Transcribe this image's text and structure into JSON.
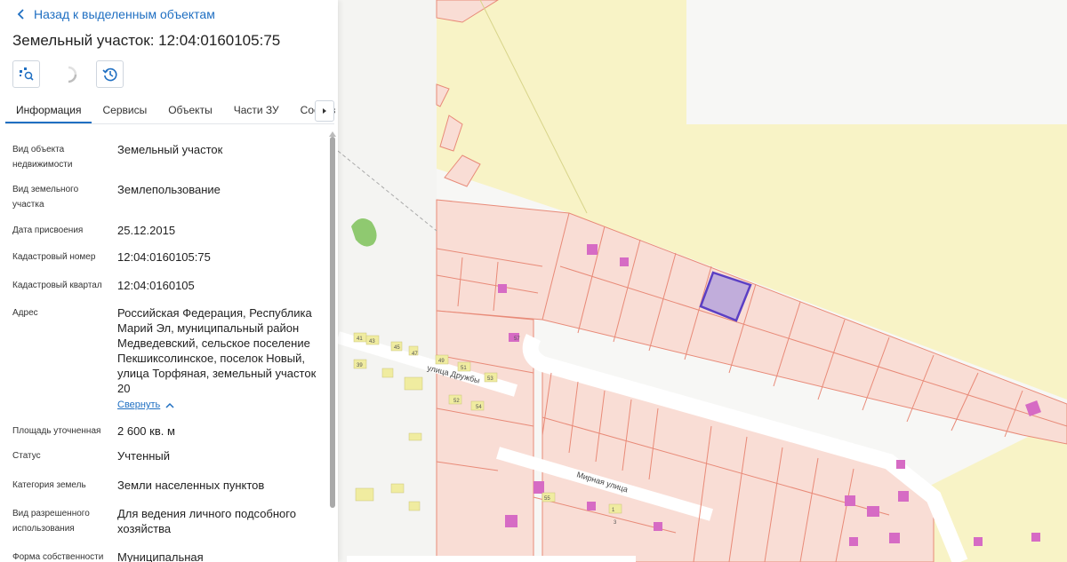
{
  "panel": {
    "back_label": "Назад к выделенным объектам",
    "title": "Земельный участок: 12:04:0160105:75",
    "tabs": [
      {
        "label": "Информация",
        "active": true
      },
      {
        "label": "Сервисы"
      },
      {
        "label": "Объекты"
      },
      {
        "label": "Части ЗУ"
      },
      {
        "label": "Состав"
      }
    ],
    "fields": [
      {
        "label": "Вид объекта недвижимости",
        "value": "Земельный участок"
      },
      {
        "label": "Вид земельного участка",
        "value": "Землепользование"
      },
      {
        "label": "Дата присвоения",
        "value": "25.12.2015"
      },
      {
        "label": "Кадастровый номер",
        "value": "12:04:0160105:75"
      },
      {
        "label": "Кадастровый квартал",
        "value": "12:04:0160105"
      },
      {
        "label": "Адрес",
        "value": "Российская Федерация, Республика Марий Эл, муниципальный район Медведевский, сельское поселение Пекшиксолинское, поселок Новый, улица Торфяная, земельный участок 20",
        "link": "Свернуть"
      },
      {
        "label": "Площадь уточненная",
        "value": "2 600 кв. м"
      },
      {
        "label": "Статус",
        "value": "Учтенный"
      },
      {
        "label": "Категория земель",
        "value": "Земли населенных пунктов"
      },
      {
        "label": "Вид разрешенного использования",
        "value": "Для ведения личного подсобного хозяйства"
      },
      {
        "label": "Форма собственности",
        "value": "Муниципальная"
      }
    ]
  },
  "map": {
    "street_labels": [
      "улица Дружбы",
      "Мирная улица"
    ],
    "house_numbers": [
      "41",
      "43",
      "45",
      "47",
      "49",
      "51",
      "53",
      "55",
      "57",
      "52",
      "54",
      "39",
      "1",
      "3"
    ]
  },
  "colors": {
    "accent": "#1f6fc2",
    "parcel_fill": "#f9ddd5",
    "parcel_stroke": "#e88a78",
    "zone_yellow": "#f8f3c6",
    "selected_fill": "#b7a4dc",
    "selected_stroke": "#5b3fc4",
    "building": "#d66bc4"
  }
}
